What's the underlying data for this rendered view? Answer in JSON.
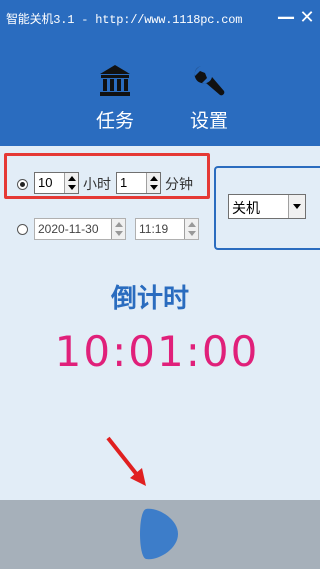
{
  "window": {
    "title": "智能关机3.1 - http://www.1118pc.com",
    "minimize_label": "—",
    "close_label": "✕"
  },
  "toolbar": {
    "task_label": "任务",
    "settings_label": "设置"
  },
  "timer_mode": {
    "hours_value": "10",
    "hours_unit": "小时",
    "minutes_value": "1",
    "minutes_unit": "分钟",
    "selected": true
  },
  "datetime_mode": {
    "date_value": "2020-11-30",
    "time_value": "11:19",
    "selected": false
  },
  "action_select": {
    "value": "关机"
  },
  "countdown": {
    "label": "倒计时",
    "value": "10:01:00"
  },
  "colors": {
    "accent": "#2a6cbf",
    "countdown": "#e0207a",
    "highlight_frame": "#e53935",
    "footer": "#a6b0ba",
    "play_button": "#3d7dc9"
  },
  "icons": [
    "bank-icon",
    "wrench-icon",
    "play-icon",
    "red-arrow-annotation"
  ]
}
